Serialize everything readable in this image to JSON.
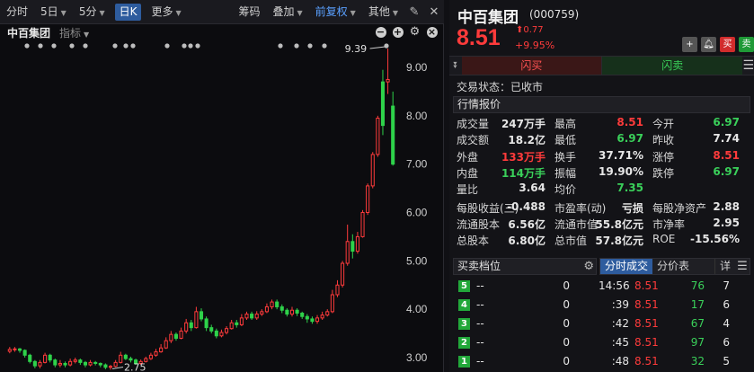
{
  "toolbar": {
    "items": [
      "分时",
      "5日",
      "5分",
      "日K",
      "更多",
      "筹码",
      "叠加",
      "前复权",
      "其他"
    ]
  },
  "chart_header": {
    "name": "中百集团",
    "indicator": "指标"
  },
  "chart_data": {
    "type": "candlestick",
    "y_ticks": [
      "9.00",
      "8.00",
      "7.00",
      "6.00",
      "5.00",
      "4.00",
      "3.00"
    ],
    "ylim": [
      2.75,
      9.55
    ],
    "annotations": [
      {
        "text": "9.39",
        "value": 9.39
      },
      {
        "text": "2.75",
        "value": 2.75
      }
    ],
    "candles": [
      {
        "o": 3.13,
        "c": 3.17,
        "h": 3.22,
        "l": 3.09
      },
      {
        "o": 3.17,
        "c": 3.18,
        "h": 3.22,
        "l": 3.12
      },
      {
        "o": 3.18,
        "c": 3.15,
        "h": 3.2,
        "l": 3.1
      },
      {
        "o": 3.15,
        "c": 3.05,
        "h": 3.17,
        "l": 3.0
      },
      {
        "o": 3.05,
        "c": 2.92,
        "h": 3.08,
        "l": 2.88
      },
      {
        "o": 2.92,
        "c": 2.83,
        "h": 2.95,
        "l": 2.78
      },
      {
        "o": 2.83,
        "c": 2.9,
        "h": 2.95,
        "l": 2.78
      },
      {
        "o": 2.9,
        "c": 3.05,
        "h": 3.1,
        "l": 2.88
      },
      {
        "o": 3.05,
        "c": 2.95,
        "h": 3.08,
        "l": 2.9
      },
      {
        "o": 2.95,
        "c": 2.85,
        "h": 2.98,
        "l": 2.8
      },
      {
        "o": 2.85,
        "c": 2.88,
        "h": 2.95,
        "l": 2.8
      },
      {
        "o": 2.88,
        "c": 2.85,
        "h": 2.92,
        "l": 2.8
      },
      {
        "o": 2.85,
        "c": 2.92,
        "h": 2.98,
        "l": 2.82
      },
      {
        "o": 2.92,
        "c": 2.95,
        "h": 3.0,
        "l": 2.88
      },
      {
        "o": 2.95,
        "c": 2.9,
        "h": 2.98,
        "l": 2.85
      },
      {
        "o": 2.9,
        "c": 2.85,
        "h": 2.93,
        "l": 2.8
      },
      {
        "o": 2.85,
        "c": 2.9,
        "h": 2.95,
        "l": 2.82
      },
      {
        "o": 2.9,
        "c": 2.88,
        "h": 2.93,
        "l": 2.84
      },
      {
        "o": 2.88,
        "c": 2.85,
        "h": 2.9,
        "l": 2.8
      },
      {
        "o": 2.85,
        "c": 2.8,
        "h": 2.88,
        "l": 2.76
      },
      {
        "o": 2.8,
        "c": 2.82,
        "h": 2.85,
        "l": 2.75
      },
      {
        "o": 2.82,
        "c": 2.9,
        "h": 2.95,
        "l": 2.8
      },
      {
        "o": 2.9,
        "c": 3.05,
        "h": 3.12,
        "l": 2.88
      },
      {
        "o": 3.05,
        "c": 2.98,
        "h": 3.08,
        "l": 2.95
      },
      {
        "o": 2.98,
        "c": 2.95,
        "h": 3.02,
        "l": 2.9
      },
      {
        "o": 2.95,
        "c": 2.88,
        "h": 2.98,
        "l": 2.85
      },
      {
        "o": 2.88,
        "c": 2.92,
        "h": 2.96,
        "l": 2.85
      },
      {
        "o": 2.92,
        "c": 2.98,
        "h": 3.02,
        "l": 2.9
      },
      {
        "o": 2.98,
        "c": 3.05,
        "h": 3.1,
        "l": 2.95
      },
      {
        "o": 3.05,
        "c": 3.12,
        "h": 3.18,
        "l": 3.02
      },
      {
        "o": 3.12,
        "c": 3.2,
        "h": 3.28,
        "l": 3.1
      },
      {
        "o": 3.2,
        "c": 3.35,
        "h": 3.42,
        "l": 3.18
      },
      {
        "o": 3.35,
        "c": 3.48,
        "h": 3.55,
        "l": 3.3
      },
      {
        "o": 3.48,
        "c": 3.4,
        "h": 3.52,
        "l": 3.35
      },
      {
        "o": 3.4,
        "c": 3.55,
        "h": 3.62,
        "l": 3.38
      },
      {
        "o": 3.55,
        "c": 3.72,
        "h": 3.8,
        "l": 3.5
      },
      {
        "o": 3.72,
        "c": 3.62,
        "h": 3.78,
        "l": 3.55
      },
      {
        "o": 3.62,
        "c": 3.95,
        "h": 4.05,
        "l": 3.6
      },
      {
        "o": 3.95,
        "c": 3.8,
        "h": 4.02,
        "l": 3.75
      },
      {
        "o": 3.8,
        "c": 3.62,
        "h": 3.85,
        "l": 3.55
      },
      {
        "o": 3.62,
        "c": 3.55,
        "h": 3.68,
        "l": 3.5
      },
      {
        "o": 3.55,
        "c": 3.45,
        "h": 3.6,
        "l": 3.4
      },
      {
        "o": 3.45,
        "c": 3.52,
        "h": 3.58,
        "l": 3.42
      },
      {
        "o": 3.52,
        "c": 3.6,
        "h": 3.65,
        "l": 3.48
      },
      {
        "o": 3.6,
        "c": 3.72,
        "h": 3.78,
        "l": 3.58
      },
      {
        "o": 3.72,
        "c": 3.68,
        "h": 3.78,
        "l": 3.62
      },
      {
        "o": 3.68,
        "c": 3.82,
        "h": 3.9,
        "l": 3.65
      },
      {
        "o": 3.82,
        "c": 3.9,
        "h": 3.95,
        "l": 3.78
      },
      {
        "o": 3.9,
        "c": 3.82,
        "h": 3.95,
        "l": 3.78
      },
      {
        "o": 3.82,
        "c": 3.9,
        "h": 3.96,
        "l": 3.78
      },
      {
        "o": 3.9,
        "c": 3.95,
        "h": 4.0,
        "l": 3.86
      },
      {
        "o": 3.95,
        "c": 4.05,
        "h": 4.12,
        "l": 3.92
      },
      {
        "o": 4.05,
        "c": 4.15,
        "h": 4.2,
        "l": 4.0
      },
      {
        "o": 4.15,
        "c": 4.05,
        "h": 4.2,
        "l": 4.0
      },
      {
        "o": 4.05,
        "c": 3.98,
        "h": 4.1,
        "l": 3.92
      },
      {
        "o": 3.98,
        "c": 3.9,
        "h": 4.02,
        "l": 3.85
      },
      {
        "o": 3.9,
        "c": 3.98,
        "h": 4.05,
        "l": 3.85
      },
      {
        "o": 3.98,
        "c": 3.92,
        "h": 4.02,
        "l": 3.86
      },
      {
        "o": 3.92,
        "c": 3.85,
        "h": 3.95,
        "l": 3.8
      },
      {
        "o": 3.85,
        "c": 3.8,
        "h": 3.9,
        "l": 3.72
      },
      {
        "o": 3.8,
        "c": 3.75,
        "h": 3.85,
        "l": 3.7
      },
      {
        "o": 3.75,
        "c": 3.82,
        "h": 3.88,
        "l": 3.7
      },
      {
        "o": 3.82,
        "c": 3.88,
        "h": 3.95,
        "l": 3.78
      },
      {
        "o": 3.88,
        "c": 3.95,
        "h": 4.0,
        "l": 3.85
      },
      {
        "o": 3.95,
        "c": 4.3,
        "h": 4.4,
        "l": 3.92
      },
      {
        "o": 4.3,
        "c": 4.5,
        "h": 4.6,
        "l": 4.25
      },
      {
        "o": 4.5,
        "c": 4.95,
        "h": 5.0,
        "l": 4.45
      },
      {
        "o": 4.95,
        "c": 5.4,
        "h": 5.75,
        "l": 4.9
      },
      {
        "o": 5.4,
        "c": 5.2,
        "h": 5.55,
        "l": 5.05
      },
      {
        "o": 5.2,
        "c": 5.5,
        "h": 5.6,
        "l": 5.15
      },
      {
        "o": 5.5,
        "c": 6.0,
        "h": 6.05,
        "l": 5.48
      },
      {
        "o": 6.0,
        "c": 6.55,
        "h": 6.6,
        "l": 5.95
      },
      {
        "o": 6.55,
        "c": 7.2,
        "h": 7.25,
        "l": 6.5
      },
      {
        "o": 7.2,
        "c": 7.95,
        "h": 8.0,
        "l": 7.15
      },
      {
        "o": 8.7,
        "c": 7.8,
        "h": 8.95,
        "l": 7.6
      },
      {
        "o": 8.7,
        "c": 8.75,
        "h": 9.39,
        "l": 8.45
      },
      {
        "o": 8.2,
        "c": 7.0,
        "h": 8.5,
        "l": 6.97
      }
    ]
  },
  "quote": {
    "name": "中百集团",
    "code": "(000759)",
    "price": "8.51",
    "change": "0.77",
    "pct": "+9.95%",
    "btn_buy": "买",
    "btn_sell": "卖",
    "flash_buy": "闪买",
    "flash_sell": "闪卖",
    "status": "交易状态：已收市",
    "section_title": "行情报价"
  },
  "stats": [
    {
      "l1": "成交量",
      "v1": "247万手",
      "c1": "w",
      "l2": "最高",
      "v2": "8.51",
      "c2": "r",
      "l3": "今开",
      "v3": "6.97",
      "c3": "g"
    },
    {
      "l1": "成交额",
      "v1": "18.2亿",
      "c1": "w",
      "l2": "最低",
      "v2": "6.97",
      "c2": "g",
      "l3": "昨收",
      "v3": "7.74",
      "c3": "w"
    },
    {
      "l1": "外盘",
      "v1": "133万手",
      "c1": "r",
      "l2": "换手",
      "v2": "37.71%",
      "c2": "w",
      "l3": "涨停",
      "v3": "8.51",
      "c3": "r"
    },
    {
      "l1": "内盘",
      "v1": "114万手",
      "c1": "g",
      "l2": "振幅",
      "v2": "19.90%",
      "c2": "w",
      "l3": "跌停",
      "v3": "6.97",
      "c3": "g"
    },
    {
      "l1": "量比",
      "v1": "3.64",
      "c1": "w",
      "l2": "均价",
      "v2": "7.35",
      "c2": "g",
      "l3": "",
      "v3": "",
      "c3": "w"
    },
    {
      "l1": "每股收益(三)",
      "v1": "-0.488",
      "c1": "w",
      "l2": "市盈率(动)",
      "v2": "亏损",
      "c2": "w",
      "l3": "每股净资产",
      "v3": "2.88",
      "c3": "w"
    },
    {
      "l1": "流通股本",
      "v1": "6.56亿",
      "c1": "w",
      "l2": "流通市值",
      "v2": "55.8亿元",
      "c2": "w",
      "l3": "市净率",
      "v3": "2.95",
      "c3": "w"
    },
    {
      "l1": "总股本",
      "v1": "6.80亿",
      "c1": "w",
      "l2": "总市值",
      "v2": "57.8亿元",
      "c2": "w",
      "l3": "ROE",
      "v3": "-15.56%",
      "c3": "w"
    }
  ],
  "order_book": {
    "title": "买卖档位",
    "levels": [
      {
        "level": "5",
        "price": "--",
        "vol": "0"
      },
      {
        "level": "4",
        "price": "--",
        "vol": "0"
      },
      {
        "level": "3",
        "price": "--",
        "vol": "0"
      },
      {
        "level": "2",
        "price": "--",
        "vol": "0"
      },
      {
        "level": "1",
        "price": "--",
        "vol": "0"
      }
    ]
  },
  "ticks": {
    "tabs": [
      "分时成交",
      "分价表",
      "详"
    ],
    "rows": [
      {
        "time": "14:56",
        "price": "8.51",
        "vol": "76",
        "n": "7"
      },
      {
        "time": ":39",
        "price": "8.51",
        "vol": "17",
        "n": "6"
      },
      {
        "time": ":42",
        "price": "8.51",
        "vol": "67",
        "n": "4"
      },
      {
        "time": ":45",
        "price": "8.51",
        "vol": "97",
        "n": "6"
      },
      {
        "time": ":48",
        "price": "8.51",
        "vol": "32",
        "n": "5"
      }
    ]
  }
}
